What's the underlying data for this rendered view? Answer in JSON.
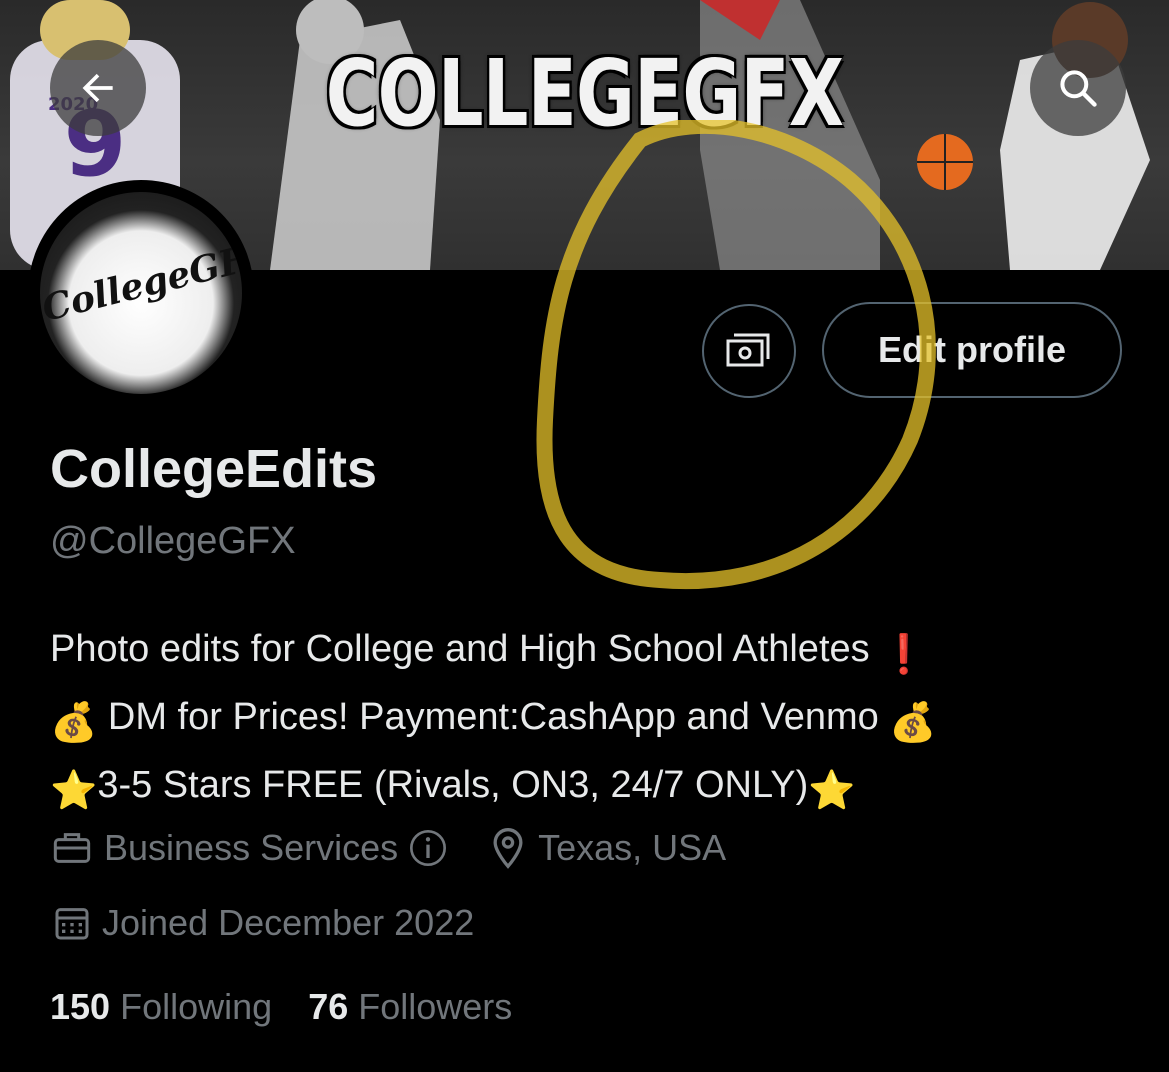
{
  "banner": {
    "title": "COLLEGEGFX",
    "jersey_number": "9",
    "jersey_year": "2020"
  },
  "avatar": {
    "logo_text": "CollegeGFX"
  },
  "header_actions": {
    "back_icon": "arrow-left-icon",
    "search_icon": "search-icon",
    "tip_icon": "money-bill-icon",
    "edit_label": "Edit profile"
  },
  "profile": {
    "display_name": "CollegeEdits",
    "handle": "@CollegeGFX",
    "bio": {
      "line1_text": "Photo edits for College and High School Athletes ",
      "line1_emoji": "❗",
      "line2_emoji_start": "💰",
      "line2_text": " DM for Prices! Payment:CashApp and Venmo ",
      "line2_emoji_end": "💰",
      "line3_emoji_start": "⭐",
      "line3_text": "3-5 Stars FREE (Rivals, ON3, 24/7 ONLY)",
      "line3_emoji_end": "⭐"
    },
    "category": "Business Services",
    "location": "Texas, USA",
    "joined": "Joined December 2022"
  },
  "stats": {
    "following_count": "150",
    "following_label": "Following",
    "followers_count": "76",
    "followers_label": "Followers"
  },
  "colors": {
    "background": "#000000",
    "primary_text": "#e7e9ea",
    "secondary_text": "#71767b",
    "border": "#536471",
    "highlight": "#e6c12a"
  }
}
